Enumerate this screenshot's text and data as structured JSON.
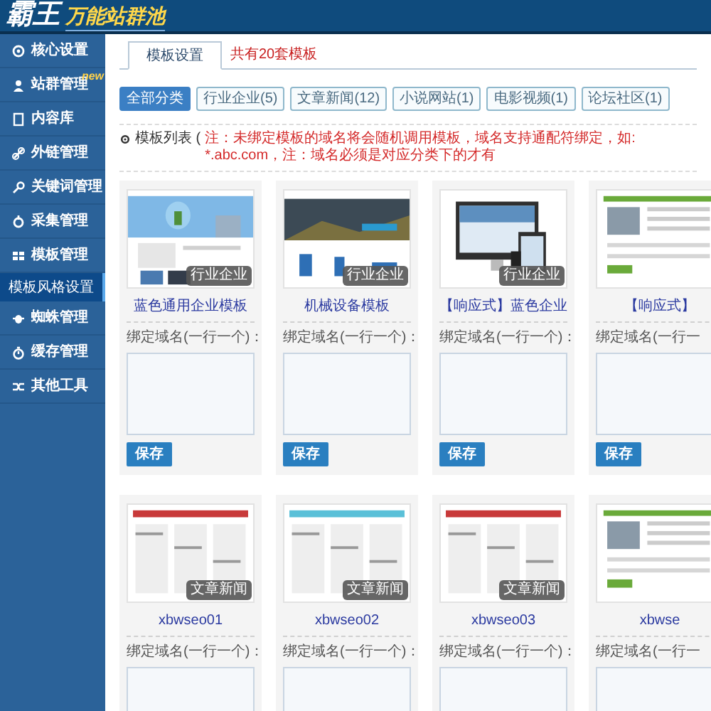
{
  "header": {
    "logo": "霸王",
    "logo_subtitle": "万能站群池"
  },
  "sidebar": {
    "items": [
      {
        "label": "核心设置",
        "selected": false
      },
      {
        "label": "站群管理",
        "selected": false,
        "badge": "new"
      },
      {
        "label": "内容库",
        "selected": false
      },
      {
        "label": "外链管理",
        "selected": false
      },
      {
        "label": "关键词管理",
        "selected": false
      },
      {
        "label": "采集管理",
        "selected": false
      },
      {
        "label": "模板管理",
        "selected": false,
        "children": [
          {
            "label": "模板风格设置",
            "selected": true
          }
        ]
      },
      {
        "label": "蜘蛛管理",
        "selected": false
      },
      {
        "label": "缓存管理",
        "selected": false
      },
      {
        "label": "其他工具",
        "selected": false
      }
    ]
  },
  "tabs": [
    {
      "label": "模板设置",
      "selected": true
    }
  ],
  "template_count": "共有20套模板",
  "filters": [
    {
      "label": "全部分类",
      "selected": true
    },
    {
      "label": "行业企业(5)",
      "selected": false
    },
    {
      "label": "文章新闻(12)",
      "selected": false
    },
    {
      "label": "小说网站(1)",
      "selected": false
    },
    {
      "label": "电影视频(1)",
      "selected": false
    },
    {
      "label": "论坛社区(1)",
      "selected": false
    }
  ],
  "notice": {
    "label": "模板列表 (",
    "note": "注：未绑定模板的域名将会随机调用模板，域名支持通配符绑定，如: *.abc.com，注：域名必须是对应分类下的才有"
  },
  "cards": [
    {
      "title": "蓝色通用企业模板",
      "tag": "行业企业",
      "field_label": "绑定域名(一行一个)：",
      "button": "保存"
    },
    {
      "title": "机械设备模板",
      "tag": "行业企业",
      "field_label": "绑定域名(一行一个)：",
      "button": "保存"
    },
    {
      "title": "【响应式】蓝色企业",
      "tag": "行业企业",
      "field_label": "绑定域名(一行一个)：",
      "button": "保存"
    },
    {
      "title": "【响应式】",
      "field_label": "绑定域名(一行一",
      "button": "保存"
    },
    {
      "title": "xbwseo01",
      "tag": "文章新闻",
      "field_label": "绑定域名(一行一个)："
    },
    {
      "title": "xbwseo02",
      "tag": "文章新闻",
      "field_label": "绑定域名(一行一个)："
    },
    {
      "title": "xbwseo03",
      "tag": "文章新闻",
      "field_label": "绑定域名(一行一个)："
    },
    {
      "title": "xbwse",
      "field_label": "绑定域名(一行一"
    }
  ]
}
